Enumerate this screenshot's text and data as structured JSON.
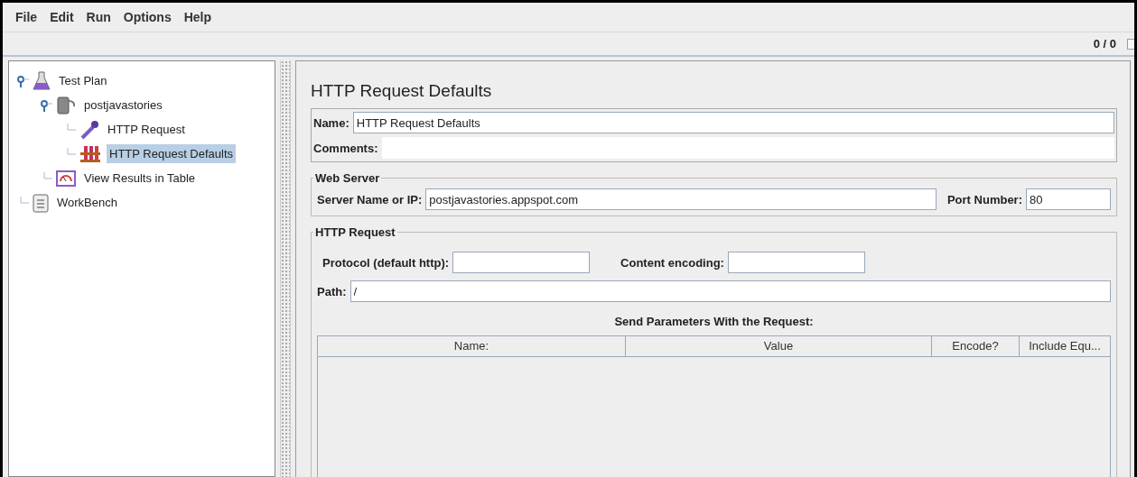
{
  "menu": [
    "File",
    "Edit",
    "Run",
    "Options",
    "Help"
  ],
  "counter": "0 / 0",
  "tree": [
    {
      "label": "Test Plan",
      "kind": "plan",
      "selected": false,
      "expanded": true,
      "children": [
        {
          "label": "postjavastories",
          "kind": "threads",
          "selected": false,
          "expanded": true,
          "children": [
            {
              "label": "HTTP Request",
              "kind": "sampler",
              "selected": false
            },
            {
              "label": "HTTP Request Defaults",
              "kind": "config",
              "selected": true
            }
          ]
        },
        {
          "label": "View Results in Table",
          "kind": "listener",
          "selected": false
        }
      ]
    },
    {
      "label": "WorkBench",
      "kind": "bench",
      "selected": false
    }
  ],
  "panel": {
    "title": "HTTP Request Defaults",
    "name": {
      "label": "Name:",
      "value": "HTTP Request Defaults"
    },
    "comments": {
      "label": "Comments:"
    },
    "web_server": {
      "title": "Web Server",
      "server": {
        "label": "Server Name or IP:",
        "value": "postjavastories.appspot.com"
      },
      "port": {
        "label": "Port Number:",
        "value": "80"
      }
    },
    "http_request": {
      "title": "HTTP Request",
      "protocol": {
        "label": "Protocol (default http):"
      },
      "encoding": {
        "label": "Content encoding:"
      },
      "path": {
        "label": "Path:",
        "value": "/"
      },
      "params_title": "Send Parameters With the Request:",
      "columns": [
        "Name:",
        "Value",
        "Encode?",
        "Include Equ..."
      ]
    }
  }
}
